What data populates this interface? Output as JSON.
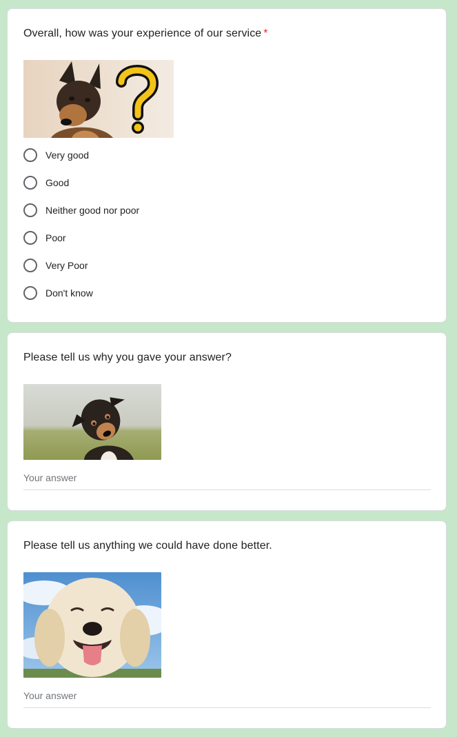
{
  "questions": [
    {
      "title": "Overall, how was your experience of our service",
      "required_mark": "*",
      "image_icon": "dog-question-mark-image",
      "options": [
        "Very good",
        "Good",
        "Neither good nor poor",
        "Poor",
        "Very Poor",
        "Don't know"
      ]
    },
    {
      "title": "Please tell us why you gave your answer?",
      "image_icon": "tilted-head-dog-image",
      "answer_placeholder": "Your answer"
    },
    {
      "title": "Please tell us anything we could have done better.",
      "image_icon": "smiling-golden-dog-image",
      "answer_placeholder": "Your answer"
    }
  ],
  "colors": {
    "background": "#c6e7c9",
    "card": "#ffffff",
    "required": "#d93025",
    "radio_border": "#5f6368",
    "placeholder": "#70757a"
  }
}
